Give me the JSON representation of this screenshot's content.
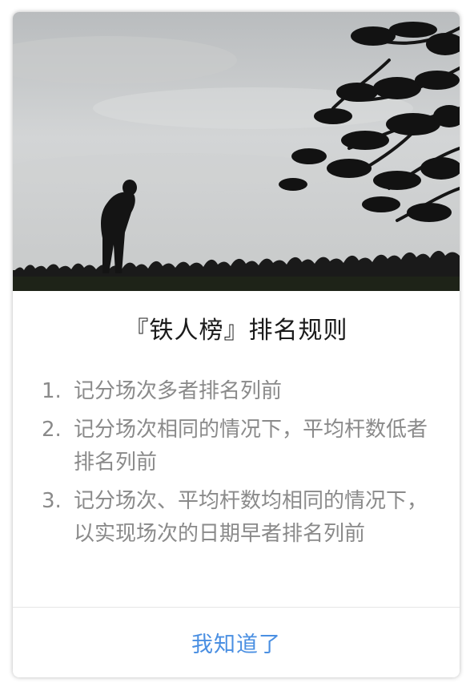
{
  "dialog": {
    "title": "『铁人榜』排名规则",
    "rules": [
      {
        "num": "1.",
        "text": "记分场次多者排名列前"
      },
      {
        "num": "2.",
        "text": "记分场次相同的情况下，平均杆数低者排名列前"
      },
      {
        "num": "3.",
        "text": "记分场次、平均杆数均相同的情况下，以实现场次的日期早者排名列前"
      }
    ],
    "confirm_label": "我知道了"
  },
  "colors": {
    "title": "#1b1b1b",
    "rule_text": "#8a8a8a",
    "confirm": "#4a8fe2",
    "divider": "#e6e6e6"
  },
  "hero": {
    "description_icon": "golf-silhouette-photo"
  }
}
